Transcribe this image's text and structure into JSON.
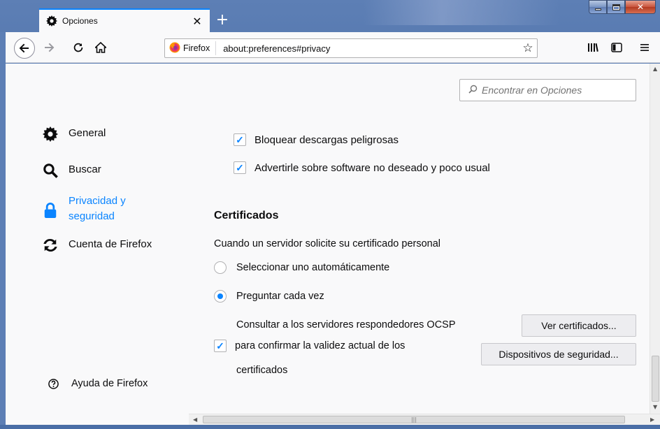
{
  "window": {
    "tab_title": "Opciones",
    "new_tab_symbol": "+"
  },
  "navbar": {
    "identity_label": "Firefox",
    "url": "about:preferences#privacy"
  },
  "search": {
    "placeholder": "Encontrar en Opciones"
  },
  "sidebar": {
    "items": [
      {
        "label": "General",
        "icon": "gear-icon"
      },
      {
        "label": "Buscar",
        "icon": "search-icon"
      },
      {
        "label": "Privacidad y seguridad",
        "icon": "lock-icon",
        "selected": true
      },
      {
        "label": "Cuenta de Firefox",
        "icon": "sync-icon"
      }
    ],
    "help_label": "Ayuda de Firefox"
  },
  "security": {
    "block_downloads_label": "Bloquear descargas peligrosas",
    "block_downloads_checked": true,
    "warn_software_label": "Advertirle sobre software no deseado y poco usual",
    "warn_software_checked": true
  },
  "certificates": {
    "title": "Certificados",
    "description": "Cuando un servidor solicite su certificado personal",
    "radio_auto_label": "Seleccionar uno automáticamente",
    "radio_auto_selected": false,
    "radio_ask_label": "Preguntar cada vez",
    "radio_ask_selected": true,
    "ocsp_line1": "Consultar a los servidores respondedores OCSP",
    "ocsp_line2": "para confirmar la validez actual de los",
    "ocsp_line3": "certificados",
    "ocsp_checked": true,
    "view_button": "Ver certificados...",
    "devices_button": "Dispositivos de seguridad..."
  },
  "colors": {
    "accent": "#0a84ff",
    "frame": "#5d7fb5",
    "close_button": "#c8533b"
  }
}
